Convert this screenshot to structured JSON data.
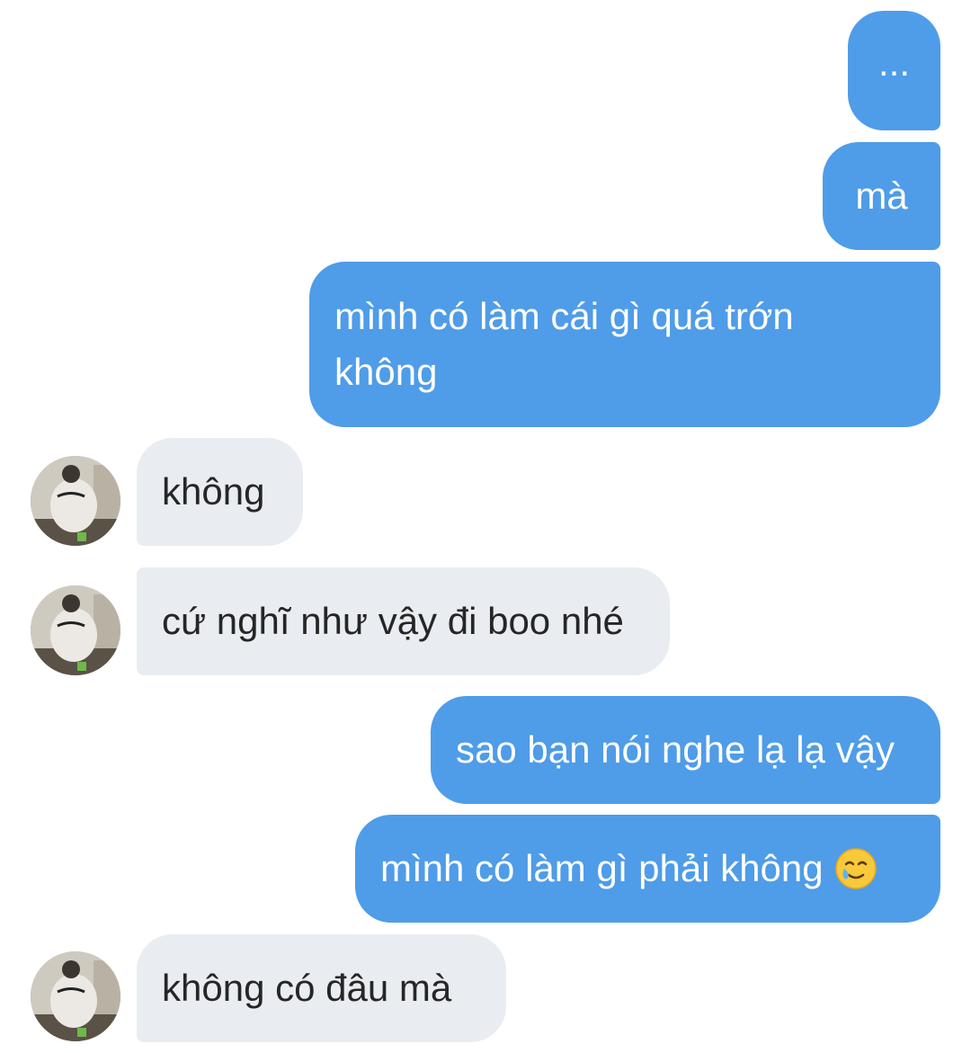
{
  "messages": [
    {
      "side": "out",
      "text": "..."
    },
    {
      "side": "out",
      "text": "mà"
    },
    {
      "side": "out",
      "lines": [
        "mình có làm cái gì quá trớn",
        "không"
      ]
    },
    {
      "side": "in",
      "text": "không"
    },
    {
      "side": "in",
      "text": "cứ nghĩ như vậy đi boo nhé"
    },
    {
      "side": "out",
      "text": "sao bạn nói nghe lạ lạ vậy"
    },
    {
      "side": "out",
      "text": "mình có làm gì phải không",
      "emoji": "smiling-face-with-tear-icon"
    },
    {
      "side": "in",
      "text": "không có đâu mà"
    }
  ],
  "colors": {
    "outgoing_bubble": "#4f9ce8",
    "incoming_bubble": "#e9edf1",
    "outgoing_text": "#ffffff",
    "incoming_text": "#262626"
  }
}
